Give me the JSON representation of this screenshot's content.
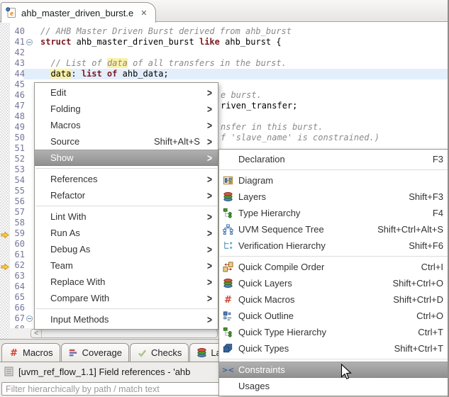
{
  "editor_tab": {
    "title": "ahb_master_driven_burst.e"
  },
  "ui": {
    "close_glyph": "✕",
    "scroll_left_glyph": "<"
  },
  "editor": {
    "first_line": 40,
    "last_line": 68,
    "current_line": 44,
    "fold_lines": [
      41,
      67
    ],
    "marker_lines": [
      59,
      62
    ],
    "lines": [
      {
        "n": 40,
        "segments": [
          {
            "t": "// AHB Master Driven Burst derived from ahb_burst",
            "s": "comment"
          }
        ]
      },
      {
        "n": 41,
        "segments": [
          {
            "t": "struct",
            "s": "keyword"
          },
          {
            "t": " ahb_master_driven_burst ",
            "s": "code"
          },
          {
            "t": "like",
            "s": "keyword"
          },
          {
            "t": " ahb_burst {",
            "s": "code"
          }
        ]
      },
      {
        "n": 42,
        "segments": []
      },
      {
        "n": 43,
        "segments": [
          {
            "t": "  ",
            "s": "code"
          },
          {
            "t": "// List of ",
            "s": "comment"
          },
          {
            "t": "data",
            "s": "comment-highlight"
          },
          {
            "t": " of all transfers in the burst.",
            "s": "comment"
          }
        ]
      },
      {
        "n": 44,
        "segments": [
          {
            "t": "  ",
            "s": "code"
          },
          {
            "t": "data",
            "s": "occurrence"
          },
          {
            "t": ": ",
            "s": "code"
          },
          {
            "t": "list of",
            "s": "keyword"
          },
          {
            "t": " ahb_data;",
            "s": "code"
          }
        ]
      }
    ],
    "fragments": [
      {
        "line": 46,
        "t": "e burst.",
        "s": "comment"
      },
      {
        "line": 47,
        "t": "riven_transfer;",
        "s": "code"
      },
      {
        "line": 49,
        "t": "nsfer in this burst.",
        "s": "comment"
      },
      {
        "line": 50,
        "t": "f 'slave_name' is constrained.)",
        "s": "comment"
      }
    ]
  },
  "context_menu": {
    "items": [
      {
        "label": "Edit"
      },
      {
        "label": "Folding"
      },
      {
        "label": "Macros"
      },
      {
        "label": "Source",
        "shortcut": "Shift+Alt+S"
      },
      {
        "label": "Show",
        "highlighted": true
      },
      {
        "separator": true
      },
      {
        "label": "References"
      },
      {
        "label": "Refactor"
      },
      {
        "separator": true
      },
      {
        "label": "Lint With"
      },
      {
        "label": "Run As"
      },
      {
        "label": "Debug As"
      },
      {
        "label": "Team"
      },
      {
        "label": "Replace With"
      },
      {
        "label": "Compare With"
      },
      {
        "separator": true
      },
      {
        "label": "Input Methods"
      }
    ]
  },
  "show_submenu": {
    "items": [
      {
        "label": "Declaration",
        "shortcut": "F3",
        "icon": "blank"
      },
      {
        "separator": true
      },
      {
        "label": "Diagram",
        "icon": "diagram"
      },
      {
        "label": "Layers",
        "shortcut": "Shift+F3",
        "icon": "layers"
      },
      {
        "label": "Type Hierarchy",
        "shortcut": "F4",
        "icon": "type-hierarchy"
      },
      {
        "label": "UVM Sequence Tree",
        "shortcut": "Shift+Ctrl+Alt+S",
        "icon": "uvm-tree"
      },
      {
        "label": "Verification Hierarchy",
        "shortcut": "Shift+F6",
        "icon": "verif-hierarchy"
      },
      {
        "separator": true
      },
      {
        "label": "Quick Compile Order",
        "shortcut": "Ctrl+I",
        "icon": "compile-order"
      },
      {
        "label": "Quick Layers",
        "shortcut": "Shift+Ctrl+O",
        "icon": "layers"
      },
      {
        "label": "Quick Macros",
        "shortcut": "Shift+Ctrl+D",
        "icon": "hash"
      },
      {
        "label": "Quick Outline",
        "shortcut": "Ctrl+O",
        "icon": "outline"
      },
      {
        "label": "Quick Type Hierarchy",
        "shortcut": "Ctrl+T",
        "icon": "type-hierarchy"
      },
      {
        "label": "Quick Types",
        "shortcut": "Shift+Ctrl+T",
        "icon": "types"
      },
      {
        "separator": true
      },
      {
        "label": "Constraints",
        "icon": "constraints",
        "highlighted": true
      },
      {
        "label": "Usages",
        "icon": "blank"
      }
    ]
  },
  "bottom_panel": {
    "tabs": [
      {
        "label": "Macros",
        "icon": "hash"
      },
      {
        "label": "Coverage",
        "icon": "coverage"
      },
      {
        "label": "Checks",
        "icon": "check"
      },
      {
        "label": "Layers",
        "icon": "layers"
      }
    ],
    "view_title": "[uvm_ref_flow_1.1] Field references - 'ahb",
    "filter_placeholder": "Filter hierarchically by path / match text"
  },
  "colors": {
    "keyword": "#7c1921",
    "comment": "#8a8a8a",
    "occurrence_highlight": "#fbf1a7",
    "current_line": "#e3eefb",
    "menu_highlight": "#9a9a9a",
    "accent_blue": "#3465a4",
    "marker_gold": "#ffcf4a"
  }
}
